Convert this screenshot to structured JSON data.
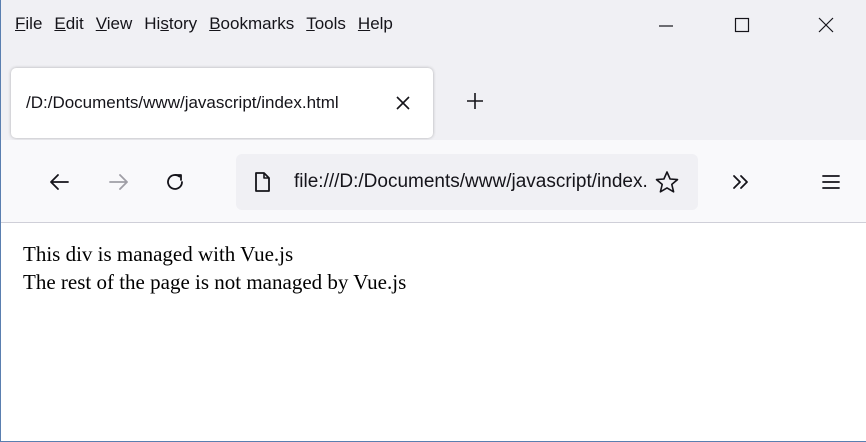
{
  "menu": {
    "items": [
      {
        "pre": "",
        "key": "F",
        "post": "ile"
      },
      {
        "pre": "",
        "key": "E",
        "post": "dit"
      },
      {
        "pre": "",
        "key": "V",
        "post": "iew"
      },
      {
        "pre": "Hi",
        "key": "s",
        "post": "tory"
      },
      {
        "pre": "",
        "key": "B",
        "post": "ookmarks"
      },
      {
        "pre": "",
        "key": "T",
        "post": "ools"
      },
      {
        "pre": "",
        "key": "H",
        "post": "elp"
      }
    ]
  },
  "window_controls": {
    "minimize_icon": "minimize-icon",
    "maximize_icon": "maximize-icon",
    "close_icon": "close-icon"
  },
  "tab": {
    "title": "/D:/Documents/www/javascript/index.html",
    "close_icon": "close-icon"
  },
  "newtab": {
    "icon": "plus-icon"
  },
  "nav": {
    "back_icon": "back-arrow-icon",
    "forward_icon": "forward-arrow-icon",
    "reload_icon": "reload-icon",
    "overflow_icon": "double-chevron-icon",
    "menu_icon": "hamburger-menu-icon"
  },
  "urlbar": {
    "page_icon": "page-icon",
    "url": "file:///D:/Documents/www/javascript/index.html",
    "star_icon": "star-icon"
  },
  "content": {
    "line1": "This div is managed with Vue.js",
    "line2": "The rest of the page is not managed by Vue.js"
  },
  "colors": {
    "chrome_bg": "#f0f0f4",
    "toolbar_bg": "#f9f9fb",
    "text": "#15141a",
    "window_border": "#5a7fb0"
  }
}
